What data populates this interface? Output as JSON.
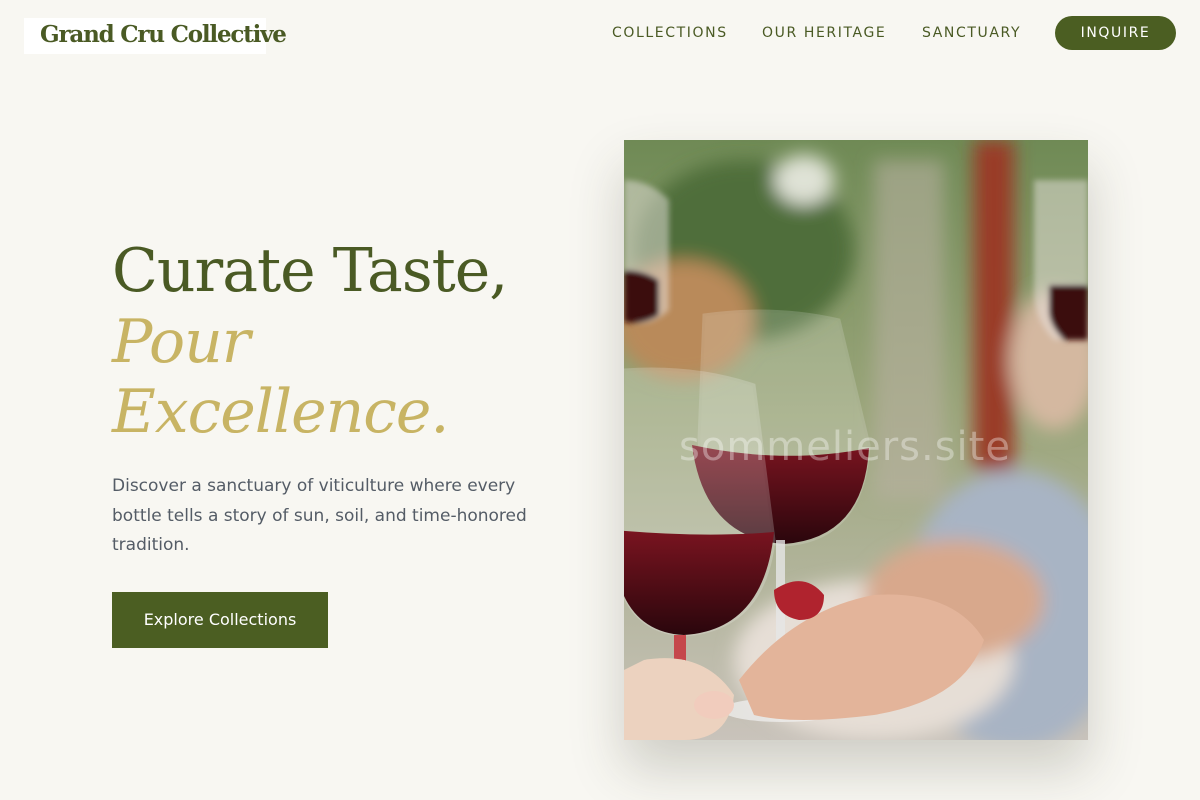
{
  "brand": {
    "name": "Grand Cru Collective"
  },
  "nav": {
    "items": [
      "COLLECTIONS",
      "OUR HERITAGE",
      "SANCTUARY"
    ],
    "cta_label": "INQUIRE"
  },
  "hero": {
    "headline_line1": "Curate Taste,",
    "headline_line2": "Pour",
    "headline_line3": "Excellence.",
    "description": "Discover a sanctuary of viticulture where every bottle tells a story of sun, soil, and time-honored tradition.",
    "cta_label": "Explore Collections",
    "image_watermark": "sommeliers.site"
  },
  "colors": {
    "background": "#f8f7f2",
    "primary_olive": "#4b5e22",
    "accent_gold": "#c8b464",
    "body_text": "#545c66"
  },
  "icons": []
}
